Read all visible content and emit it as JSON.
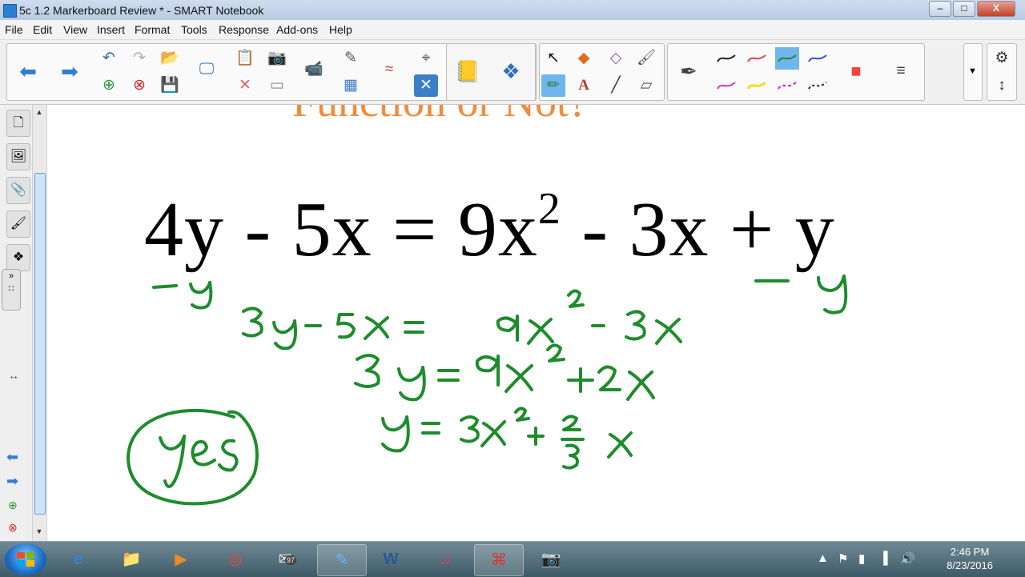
{
  "window": {
    "title": "5c 1.2 Markerboard Review * - SMART Notebook",
    "minimize": "–",
    "maximize": "□",
    "close": "X"
  },
  "menu": [
    "File",
    "Edit",
    "View",
    "Insert",
    "Format",
    "Tools",
    "Response",
    "Add-ons",
    "Help"
  ],
  "page": {
    "heading": "Function or Not?",
    "equation": {
      "lhs": "4y - 5x = 9x",
      "exponent": "2",
      "rhs": " - 3x + y"
    },
    "ink_color": "#1e8c2c",
    "heading_color": "#f28b3a"
  },
  "taskbar": {
    "time": "2:46 PM",
    "date": "8/23/2016",
    "mail_badge": "97"
  },
  "icons": {
    "toolbar": [
      "back-arrow-icon",
      "forward-arrow-icon",
      "undo-icon",
      "redo-icon",
      "open-file-icon",
      "add-page-icon",
      "delete-page-icon",
      "save-icon",
      "display-icon",
      "paste-icon",
      "delete-icon",
      "screenshade-icon",
      "camera-icon",
      "document-camera-icon",
      "table-icon",
      "magic-pen-icon",
      "clear-ink-icon",
      "measurement-tools-icon",
      "clipboard-icon",
      "puzzle-icon",
      "select-icon",
      "shapes-icon",
      "eraser-icon",
      "fill-icon",
      "pen-icon",
      "creative-pens-icon",
      "text-icon",
      "line-icon",
      "eraser-tool-icon",
      "color-palette-icon",
      "line-style-icon",
      "gear-icon",
      "updown-icon"
    ]
  }
}
